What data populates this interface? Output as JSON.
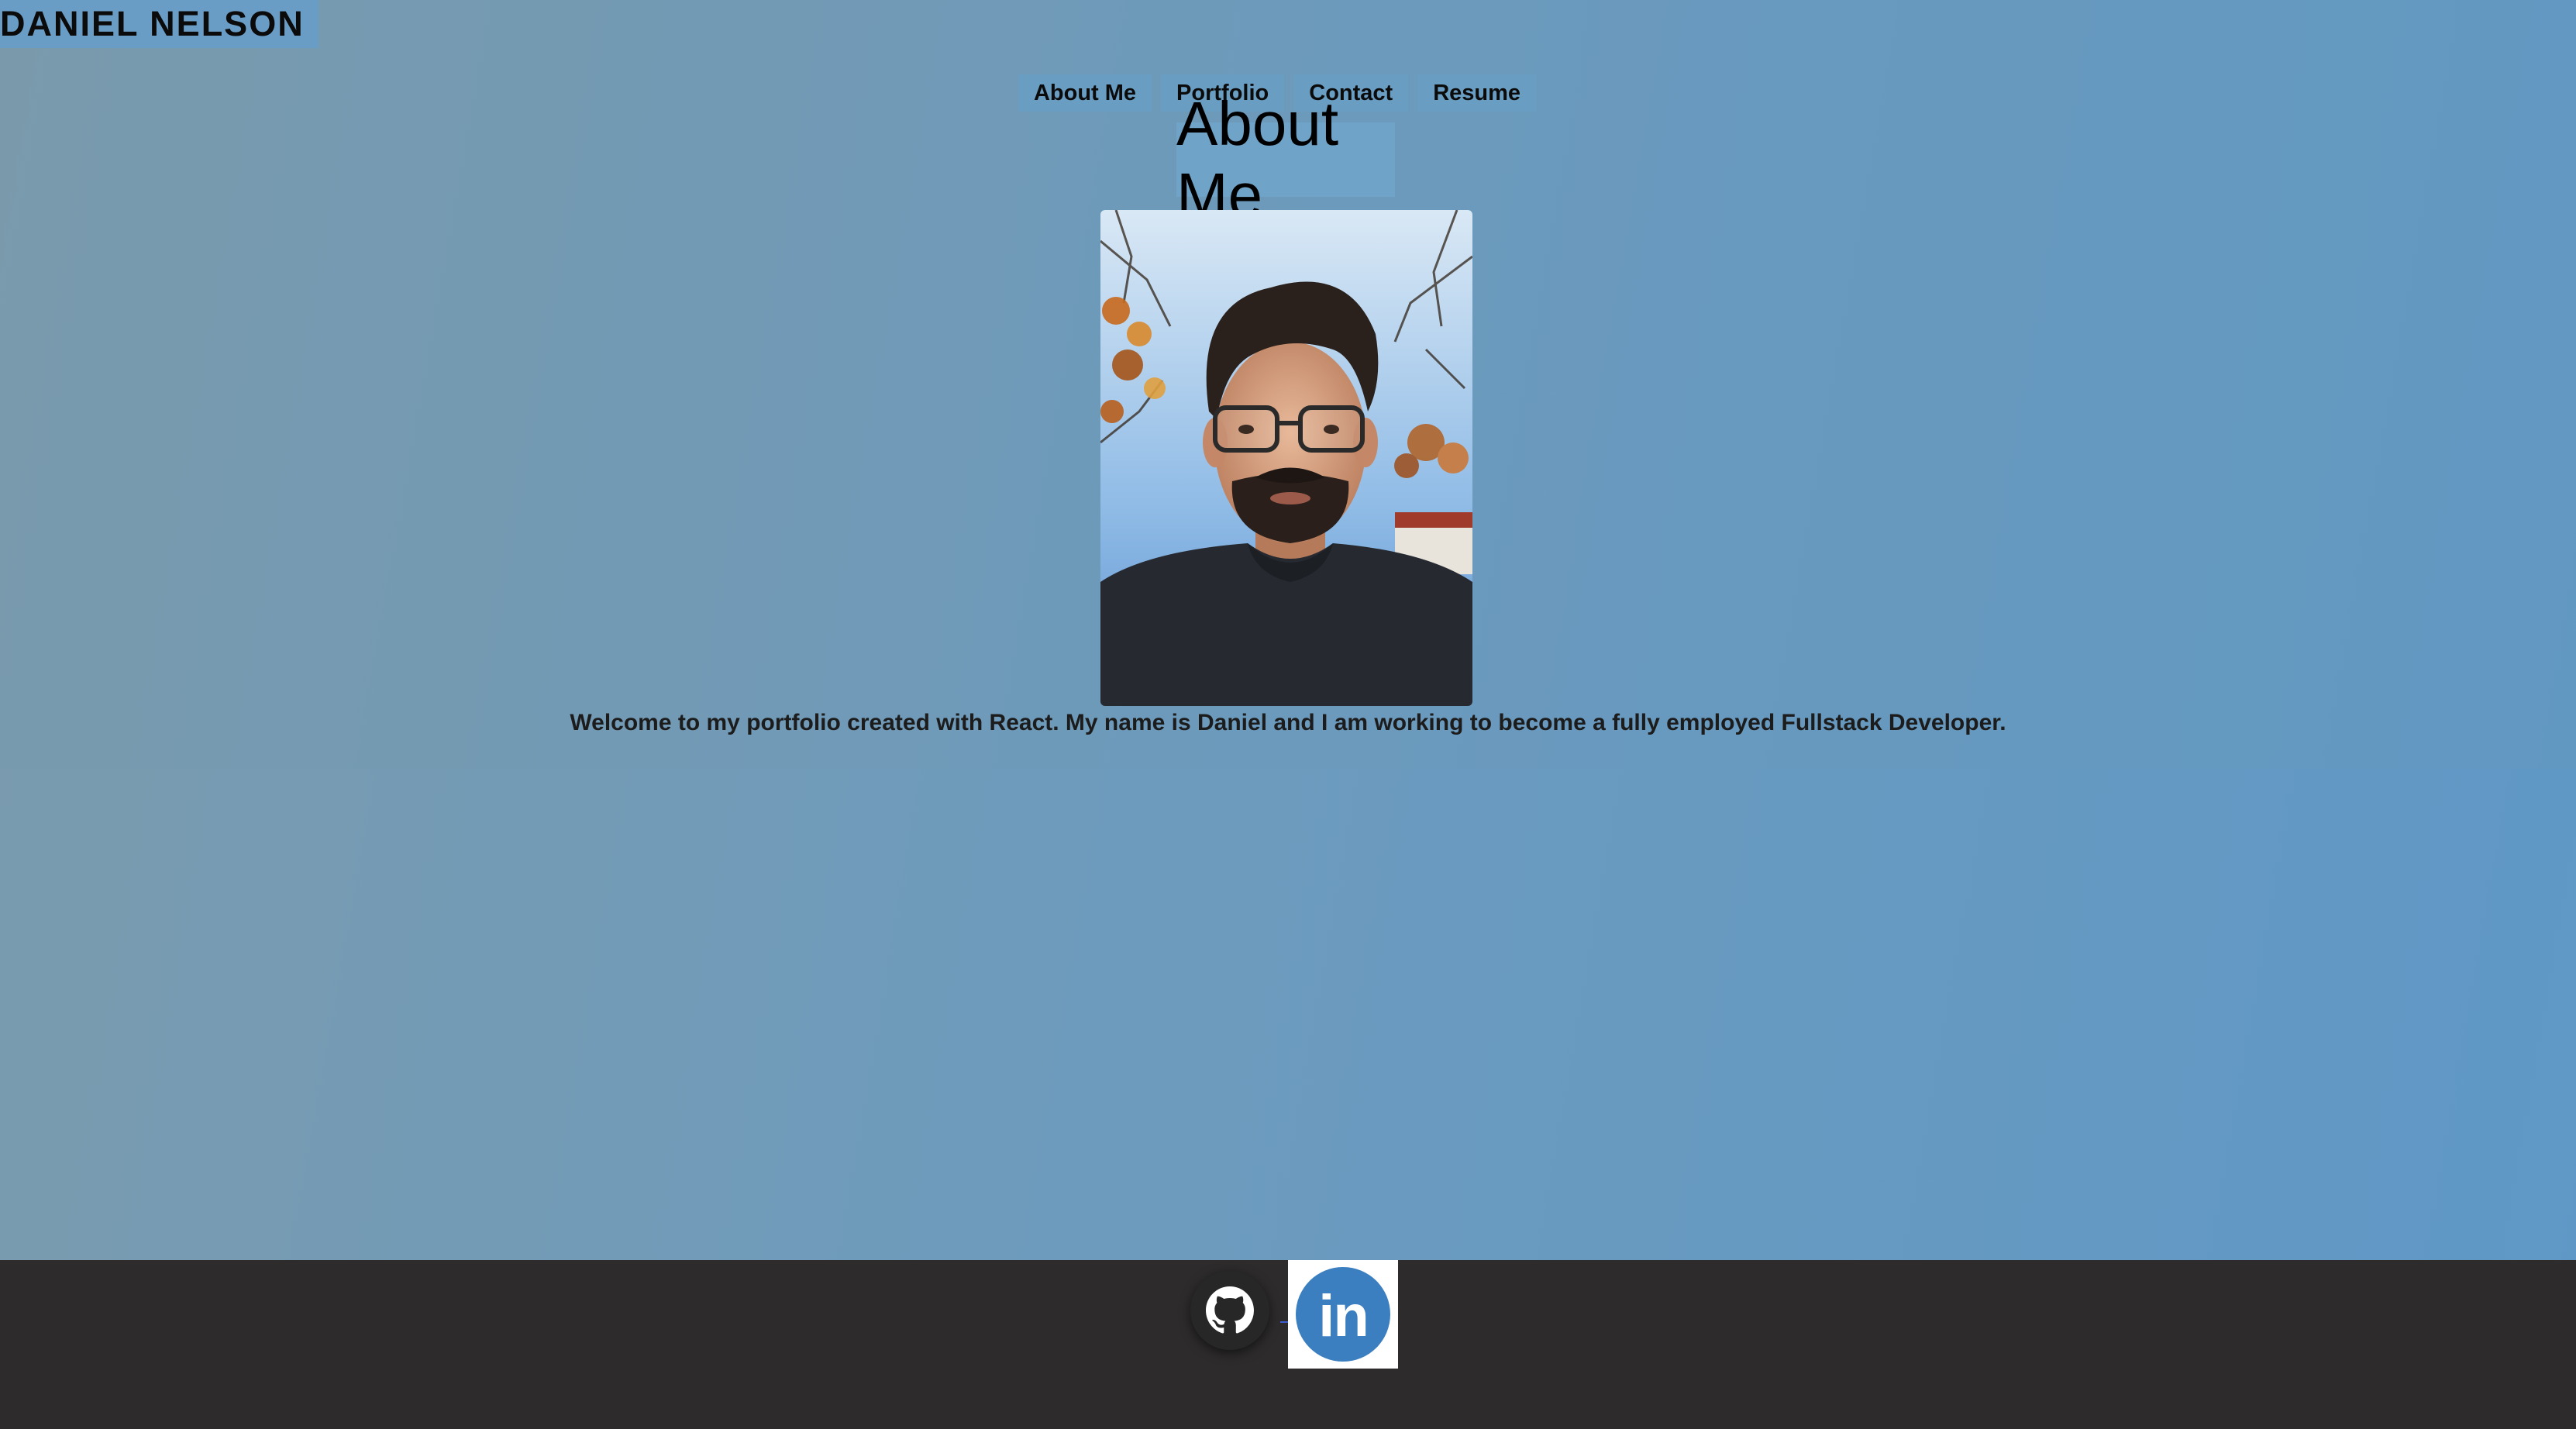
{
  "header": {
    "name": "DANIEL NELSON"
  },
  "nav": {
    "items": [
      {
        "label": "About Me"
      },
      {
        "label": "Portfolio"
      },
      {
        "label": "Contact"
      },
      {
        "label": "Resume"
      }
    ]
  },
  "main": {
    "title": "About Me",
    "photo_icon": "portrait-photo",
    "intro": "Welcome to my portfolio created with React. My name is Daniel and I am working to become a fully employed Fullstack Developer."
  },
  "footer": {
    "links": [
      {
        "icon": "github-icon"
      },
      {
        "icon": "linkedin-icon",
        "text": "in"
      }
    ]
  },
  "colors": {
    "background_start": "#7b9bad",
    "background_end": "#5f98c6",
    "footer": "#2d2b2c",
    "linkedin": "#3b7fc0"
  }
}
